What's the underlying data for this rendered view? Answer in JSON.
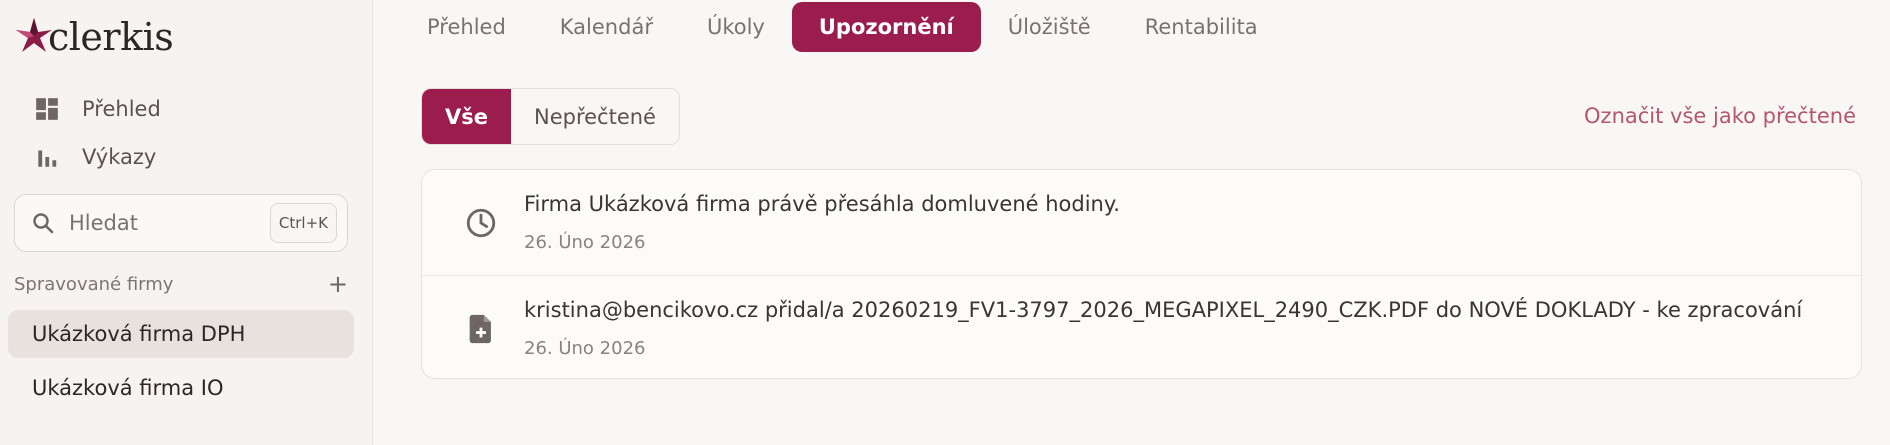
{
  "app": {
    "logo_text": "clerkis",
    "accent": "#9b1d4e"
  },
  "sidebar": {
    "nav": [
      {
        "label": "Přehled",
        "icon": "dashboard-icon"
      },
      {
        "label": "Výkazy",
        "icon": "bar-chart-icon"
      }
    ],
    "search": {
      "placeholder": "Hledat",
      "shortcut": "Ctrl+K"
    },
    "managed_header": "Spravované firmy",
    "firms": [
      {
        "label": "Ukázková firma DPH",
        "active": true
      },
      {
        "label": "Ukázková firma IO",
        "active": false
      }
    ]
  },
  "tabs": [
    {
      "label": "Přehled"
    },
    {
      "label": "Kalendář"
    },
    {
      "label": "Úkoly"
    },
    {
      "label": "Upozornění",
      "active": true
    },
    {
      "label": "Úložiště"
    },
    {
      "label": "Rentabilita"
    }
  ],
  "filter": {
    "all_label": "Vše",
    "unread_label": "Nepřečtené",
    "mark_all_label": "Označit vše jako přečtené"
  },
  "notifications": [
    {
      "icon": "clock-icon",
      "message": "Firma Ukázková firma právě přesáhla domluvené hodiny.",
      "date": "26. Úno 2026"
    },
    {
      "icon": "file-add-icon",
      "message": "kristina@bencikovo.cz přidal/a 20260219_FV1-3797_2026_MEGAPIXEL_2490_CZK.PDF do NOVÉ DOKLADY - ke zpracování",
      "date": "26. Úno 2026"
    }
  ]
}
